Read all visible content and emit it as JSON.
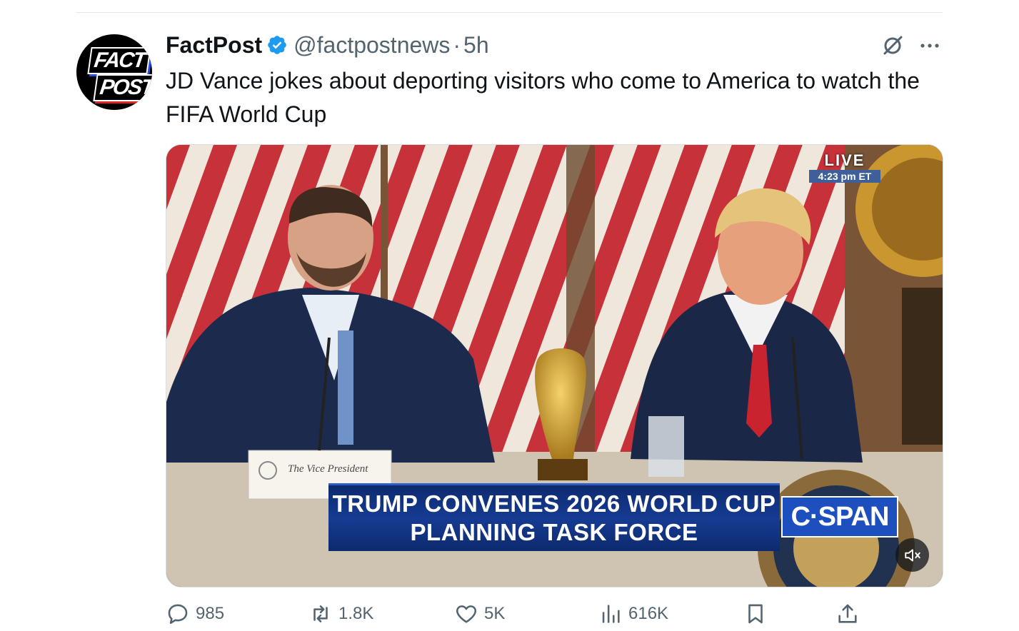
{
  "tweet": {
    "display_name": "FactPost",
    "handle": "@factpostnews",
    "separator": "·",
    "time": "5h",
    "text": "JD Vance jokes about deporting visitors who come to America to watch the FIFA World Cup",
    "avatar": {
      "line1": "FACT",
      "line2": "POST"
    },
    "verified": true,
    "accent_color": "#1d9bf0"
  },
  "media": {
    "type": "video",
    "live_label": "LIVE",
    "live_time": "4:23 pm ET",
    "chyron_line1": "TRUMP CONVENES 2026 WORLD CUP",
    "chyron_line2": "PLANNING TASK FORCE",
    "network_logo": "C·SPAN",
    "placard": "The Vice President",
    "mute_icon": "speaker-muted-icon"
  },
  "actions": {
    "replies": "985",
    "reposts": "1.8K",
    "likes": "5K",
    "views": "616K"
  },
  "icons": {
    "reply": "reply-icon",
    "repost": "repost-icon",
    "like": "heart-icon",
    "views": "views-icon",
    "bookmark": "bookmark-icon",
    "share": "share-icon",
    "grok": "grok-icon",
    "more": "more-icon"
  }
}
